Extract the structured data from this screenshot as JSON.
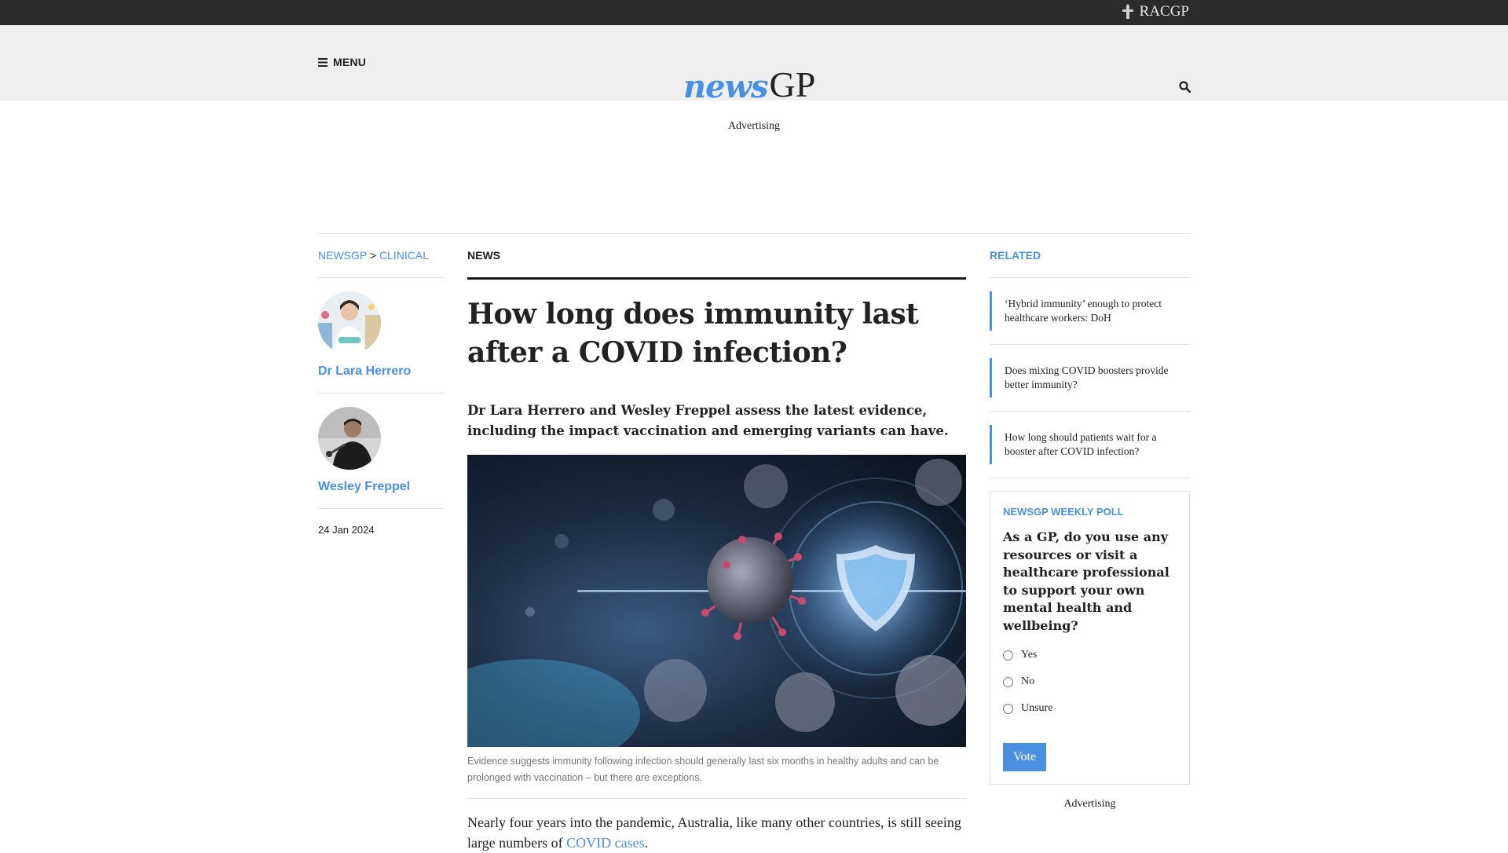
{
  "brand": {
    "racgp": "RACGP",
    "logo_news": "news",
    "logo_gp": "GP",
    "accent": "#4a90e2"
  },
  "header": {
    "menu_label": "MENU"
  },
  "ads": {
    "top": "Advertising",
    "right": "Advertising"
  },
  "breadcrumb": {
    "home": "NEWSGP",
    "separator": ">",
    "section": "CLINICAL"
  },
  "authors": [
    {
      "name": "Dr Lara Herrero"
    },
    {
      "name": "Wesley Freppel"
    }
  ],
  "article": {
    "date": "24 Jan 2024",
    "section": "NEWS",
    "headline": "How long does immunity last after a COVID infection?",
    "standfirst": "Dr Lara Herrero and Wesley Freppel assess the latest evidence, including the impact vaccination and emerging variants can have.",
    "image_caption": "Evidence suggests immunity following infection should generally last six months in healthy adults and can be prolonged with vaccination – but there are exceptions.",
    "body_start": "Nearly four years into the pandemic, Australia, like many other countries, is still seeing large numbers of ",
    "body_link": "COVID cases",
    "body_end": "."
  },
  "related": {
    "title": "RELATED",
    "items": [
      "‘Hybrid immunity’ enough to protect healthcare workers: DoH",
      "Does mixing COVID boosters provide better immunity?",
      "How long should patients wait for a booster after COVID infection?"
    ]
  },
  "poll": {
    "title": "NEWSGP WEEKLY POLL",
    "question": "As a GP, do you use any resources or visit a healthcare professional to support your own mental health and wellbeing?",
    "options": [
      "Yes",
      "No",
      "Unsure"
    ],
    "vote_label": "Vote"
  }
}
